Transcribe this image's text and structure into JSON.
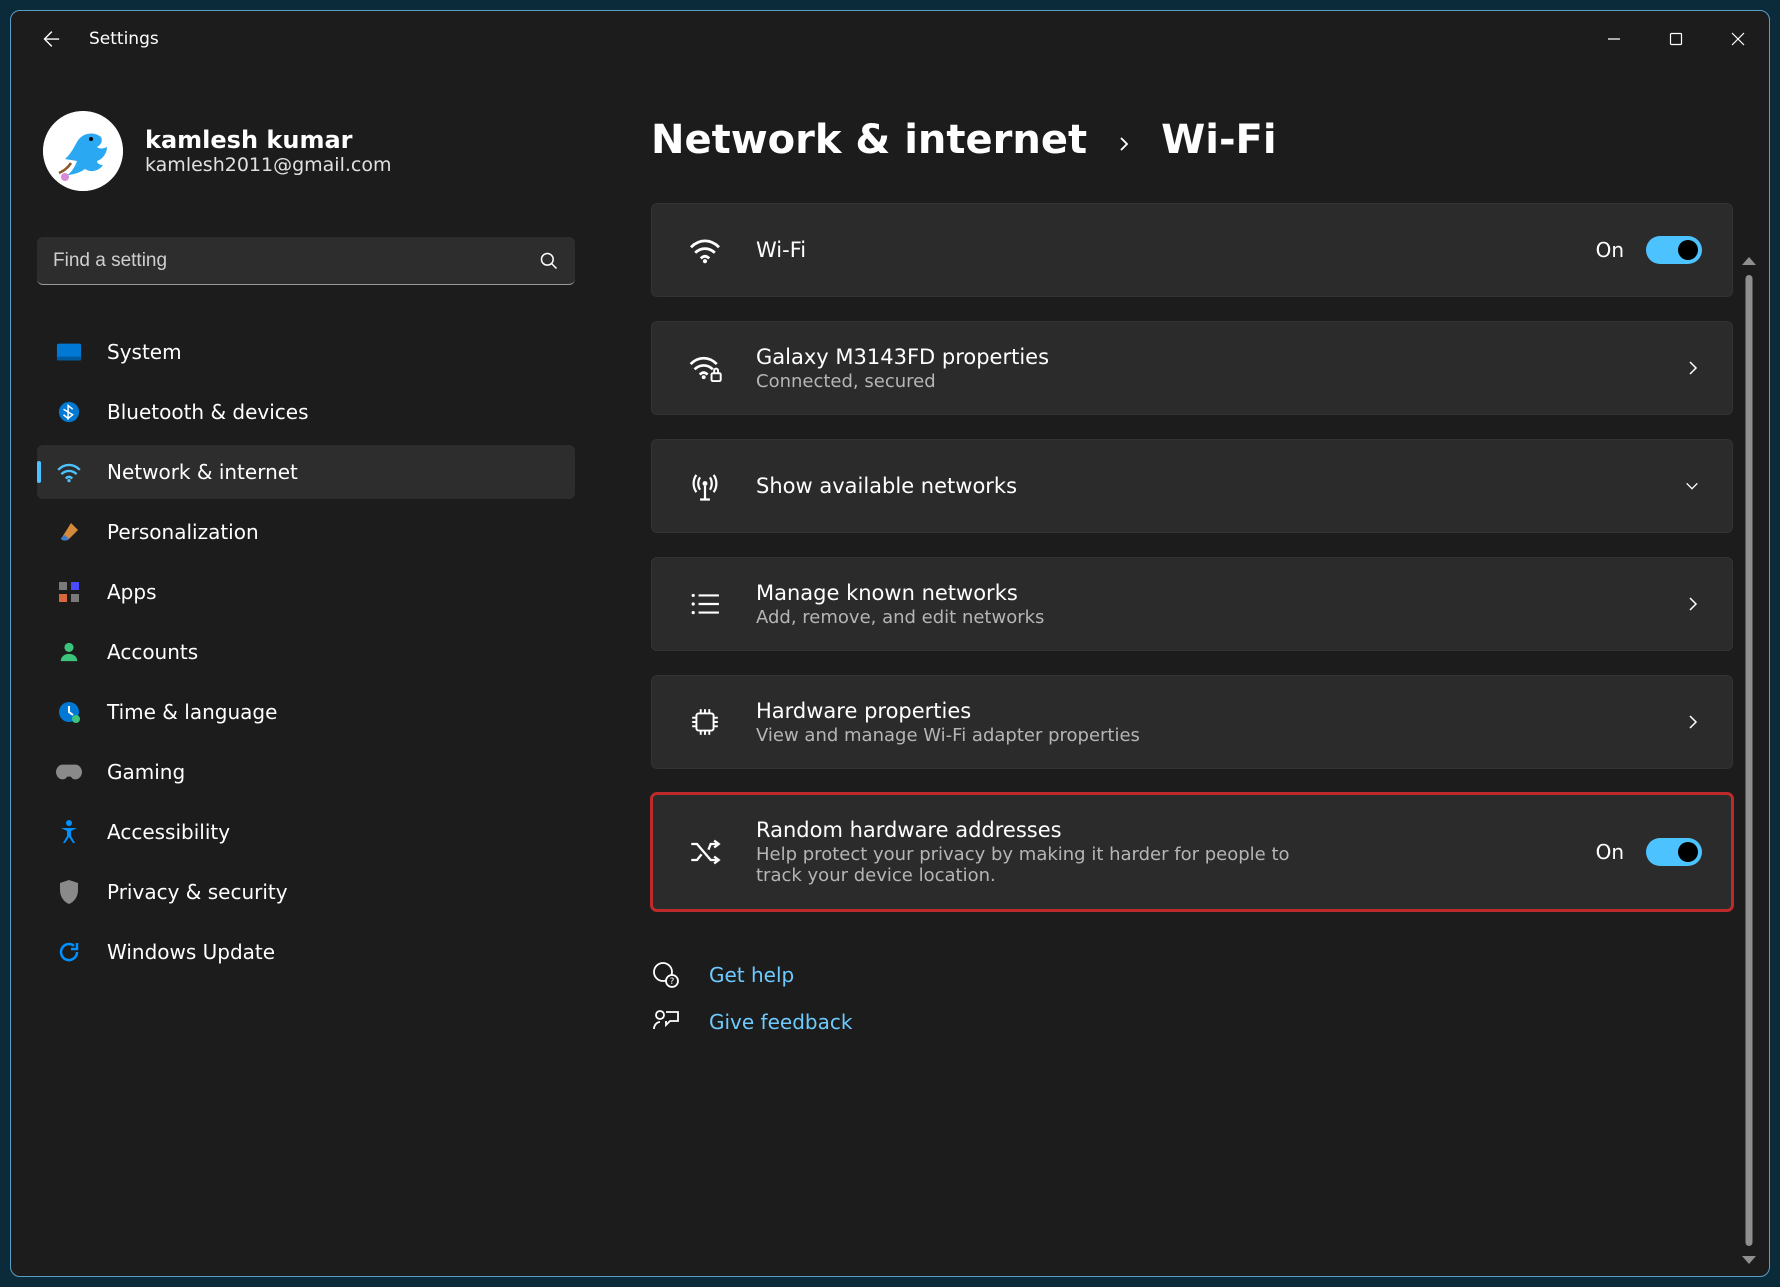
{
  "app_title": "Settings",
  "profile": {
    "name": "kamlesh kumar",
    "email": "kamlesh2011@gmail.com"
  },
  "search": {
    "placeholder": "Find a setting"
  },
  "sidebar": {
    "items": [
      {
        "label": "System"
      },
      {
        "label": "Bluetooth & devices"
      },
      {
        "label": "Network & internet"
      },
      {
        "label": "Personalization"
      },
      {
        "label": "Apps"
      },
      {
        "label": "Accounts"
      },
      {
        "label": "Time & language"
      },
      {
        "label": "Gaming"
      },
      {
        "label": "Accessibility"
      },
      {
        "label": "Privacy & security"
      },
      {
        "label": "Windows Update"
      }
    ]
  },
  "breadcrumb": {
    "parent": "Network & internet",
    "current": "Wi-Fi"
  },
  "cards": {
    "wifi": {
      "title": "Wi-Fi",
      "state": "On"
    },
    "network": {
      "title": "Galaxy M3143FD properties",
      "sub": "Connected, secured"
    },
    "show": {
      "title": "Show available networks"
    },
    "known": {
      "title": "Manage known networks",
      "sub": "Add, remove, and edit networks"
    },
    "hardware": {
      "title": "Hardware properties",
      "sub": "View and manage Wi-Fi adapter properties"
    },
    "random": {
      "title": "Random hardware addresses",
      "sub": "Help protect your privacy by making it harder for people to track your device location.",
      "state": "On"
    }
  },
  "help": {
    "get_help": "Get help",
    "feedback": "Give feedback"
  }
}
